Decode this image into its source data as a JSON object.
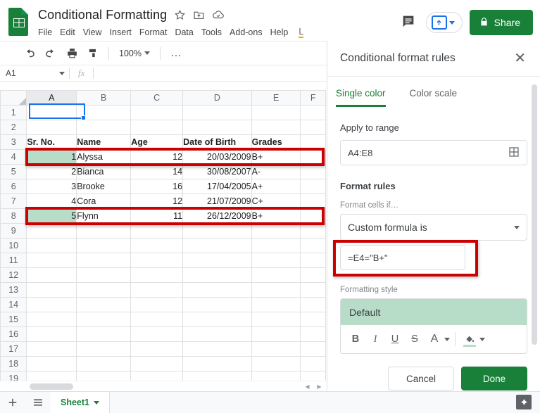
{
  "header": {
    "doc_title": "Conditional Formatting",
    "star_icon": "star-icon",
    "move_icon": "move-to-folder-icon",
    "cloud_icon": "cloud-saved-icon",
    "menus": [
      "File",
      "Edit",
      "View",
      "Insert",
      "Format",
      "Data",
      "Tools",
      "Add-ons",
      "Help"
    ],
    "edit_indicator": "L",
    "comment_icon": "comment-icon",
    "present_icon": "present-icon",
    "share_label": "Share",
    "lock_icon": "lock-icon"
  },
  "toolbar": {
    "undo_icon": "undo-icon",
    "redo_icon": "redo-icon",
    "print_icon": "print-icon",
    "paint_icon": "paint-format-icon",
    "zoom_value": "100%",
    "more_label": "…",
    "collapse_icon": "chevron-up-icon"
  },
  "formula_bar": {
    "name_box_value": "A1",
    "fx_label": "fx",
    "value": ""
  },
  "sheet": {
    "columns": [
      "A",
      "B",
      "C",
      "D",
      "E",
      "F"
    ],
    "selected_column": "A",
    "rows": [
      {
        "num": "1",
        "cells": [
          "",
          "",
          "",
          "",
          ""
        ]
      },
      {
        "num": "2",
        "cells": [
          "",
          "",
          "",
          "",
          ""
        ]
      },
      {
        "num": "3",
        "cells": [
          "Sr. No.",
          "Name",
          "Age",
          "Date of Birth",
          "Grades"
        ]
      },
      {
        "num": "4",
        "cells": [
          "1",
          "Alyssa",
          "12",
          "20/03/2009",
          "B+"
        ]
      },
      {
        "num": "5",
        "cells": [
          "2",
          "Bianca",
          "14",
          "30/08/2007",
          "A-"
        ]
      },
      {
        "num": "6",
        "cells": [
          "3",
          "Brooke",
          "16",
          "17/04/2005",
          "A+"
        ]
      },
      {
        "num": "7",
        "cells": [
          "4",
          "Cora",
          "12",
          "21/07/2009",
          "C+"
        ]
      },
      {
        "num": "8",
        "cells": [
          "5",
          "Flynn",
          "11",
          "26/12/2009",
          "B+"
        ]
      },
      {
        "num": "9",
        "cells": [
          "",
          "",
          "",
          "",
          ""
        ]
      },
      {
        "num": "10",
        "cells": [
          "",
          "",
          "",
          "",
          ""
        ]
      },
      {
        "num": "11",
        "cells": [
          "",
          "",
          "",
          "",
          ""
        ]
      },
      {
        "num": "12",
        "cells": [
          "",
          "",
          "",
          "",
          ""
        ]
      },
      {
        "num": "13",
        "cells": [
          "",
          "",
          "",
          "",
          ""
        ]
      },
      {
        "num": "14",
        "cells": [
          "",
          "",
          "",
          "",
          ""
        ]
      },
      {
        "num": "15",
        "cells": [
          "",
          "",
          "",
          "",
          ""
        ]
      },
      {
        "num": "16",
        "cells": [
          "",
          "",
          "",
          "",
          ""
        ]
      },
      {
        "num": "17",
        "cells": [
          "",
          "",
          "",
          "",
          ""
        ]
      },
      {
        "num": "18",
        "cells": [
          "",
          "",
          "",
          "",
          ""
        ]
      },
      {
        "num": "19",
        "cells": [
          "",
          "",
          "",
          "",
          ""
        ]
      }
    ],
    "highlight_fill_color": "#b7ddc8",
    "annotation_color": "#cc0000",
    "selection_color": "#1a73e8"
  },
  "panel": {
    "title": "Conditional format rules",
    "close_icon": "close-icon",
    "tabs": [
      {
        "label": "Single color",
        "active": true
      },
      {
        "label": "Color scale",
        "active": false
      }
    ],
    "apply_to_range_label": "Apply to range",
    "range_value": "A4:E8",
    "range_picker_icon": "select-data-range-icon",
    "format_rules_label": "Format rules",
    "format_cells_if_label": "Format cells if…",
    "condition_value": "Custom formula is",
    "condition_caret_icon": "chevron-down-icon",
    "formula_value": "=E4=\"B+\"",
    "formatting_style_label": "Formatting style",
    "preview_text": "Default",
    "style_buttons": [
      "B",
      "I",
      "U",
      "S",
      "A"
    ],
    "fill_icon": "fill-color-icon",
    "fill_color": "#b7ddc8",
    "cancel_label": "Cancel",
    "done_label": "Done"
  },
  "bottom": {
    "add_sheet_icon": "add-sheet-icon",
    "all_sheets_icon": "all-sheets-icon",
    "sheet_tab_label": "Sheet1",
    "sheet_tab_caret_icon": "chevron-down-icon",
    "explore_icon": "explore-icon"
  }
}
